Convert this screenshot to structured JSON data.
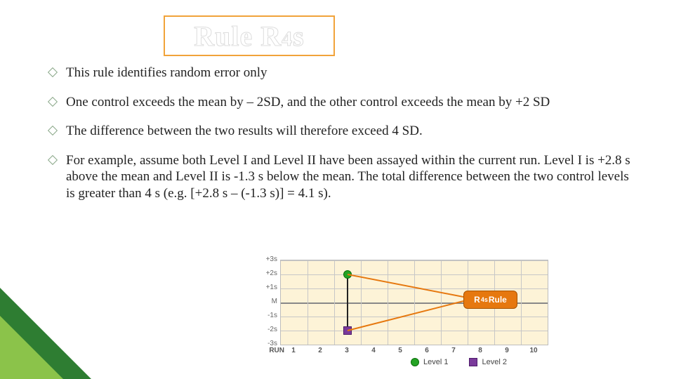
{
  "title": {
    "main": "Rule R",
    "sub": "4",
    "tail": "s"
  },
  "bullets": [
    "This rule identifies random error only",
    "One control exceeds the mean by – 2SD, and the other control exceeds the mean by +2 SD",
    "The difference  between the two results will therefore exceed 4 SD.",
    "For example, assume both Level I and Level II have been assayed within the current run. Level I is +2.8 s above the mean and Level II is -1.3 s below the mean. The total difference between the two control levels is greater than 4 s (e.g. [+2.8 s – (-1.3 s)] = 4.1 s)."
  ],
  "chart_data": {
    "type": "scatter",
    "title": "",
    "xlabel": "RUN",
    "ylabel": "",
    "y_ticks": [
      "+3s",
      "+2s",
      "+1s",
      "M",
      "-1s",
      "-2s",
      "-3s"
    ],
    "x_ticks": [
      "1",
      "2",
      "3",
      "4",
      "5",
      "6",
      "7",
      "8",
      "9",
      "10"
    ],
    "ylim": [
      -3,
      3
    ],
    "series": [
      {
        "name": "Level 1",
        "marker": "circle",
        "color": "#24a324",
        "x": [
          3
        ],
        "y": [
          2.0
        ]
      },
      {
        "name": "Level 2",
        "marker": "square",
        "color": "#7a3a9b",
        "x": [
          3
        ],
        "y": [
          -2.0
        ]
      }
    ],
    "badge": {
      "prefix": "R",
      "sub": "4s",
      "suffix": " Rule"
    },
    "legend": [
      "Level 1",
      "Level 2"
    ]
  }
}
